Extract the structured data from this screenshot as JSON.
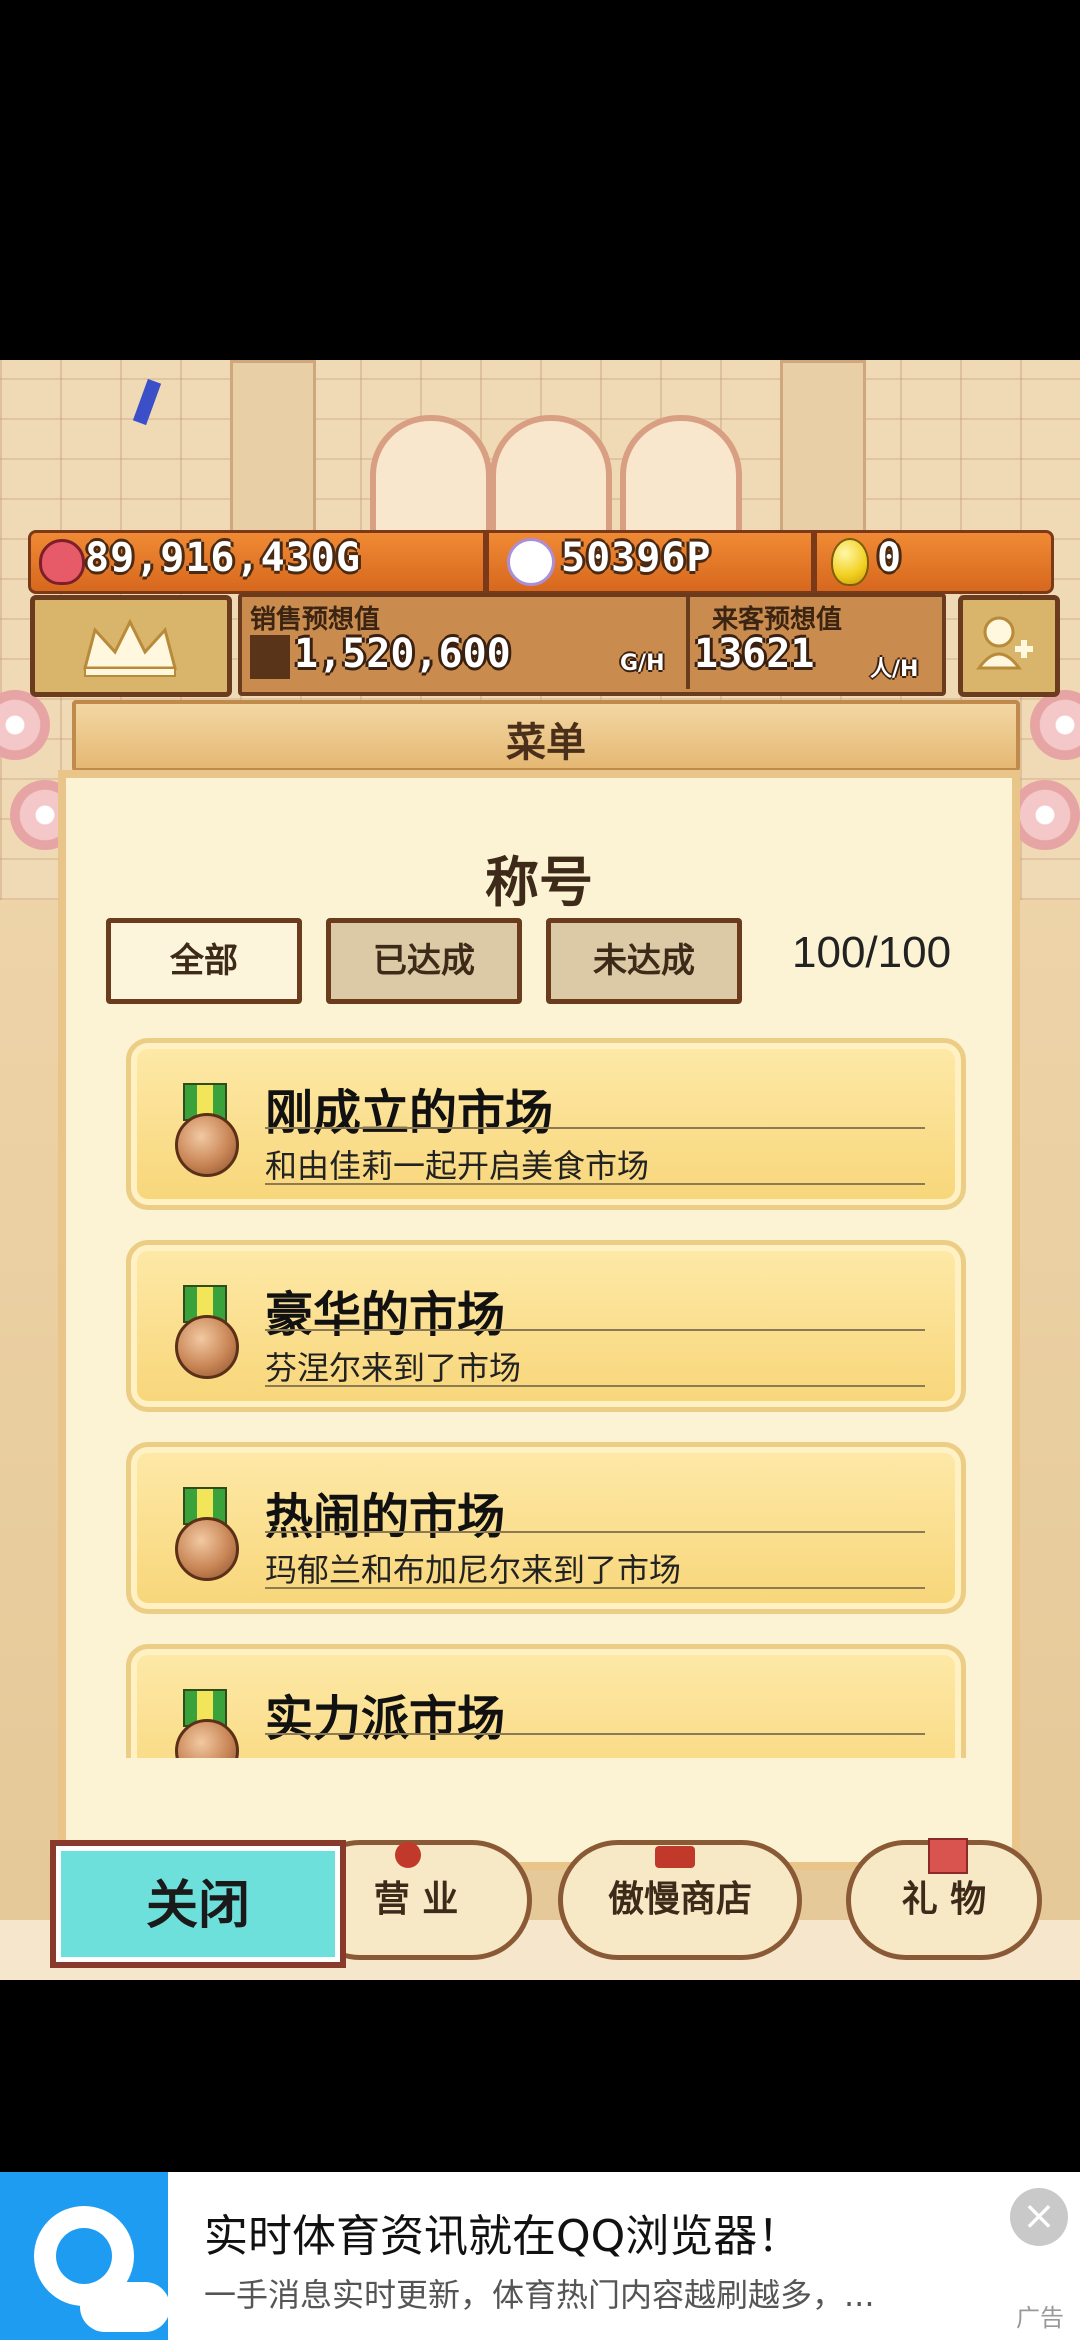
{
  "hud": {
    "gold": "89,916,430G",
    "points": "50396P",
    "eggs": "0",
    "sales_label": "销售预想值",
    "sales_value": "1,520,600",
    "sales_unit": "G/H",
    "visitors_label": "来客预想值",
    "visitors_value": "13621",
    "visitors_unit": "人/H"
  },
  "menu": {
    "header": "菜单",
    "section_title": "称号",
    "tabs": [
      "全部",
      "已达成",
      "未达成"
    ],
    "progress": "100/100"
  },
  "titles": [
    {
      "name": "刚成立的市场",
      "desc": "和由佳莉一起开启美食市场"
    },
    {
      "name": "豪华的市场",
      "desc": "芬涅尔来到了市场"
    },
    {
      "name": "热闹的市场",
      "desc": "玛郁兰和布加尼尔来到了市场"
    },
    {
      "name": "实力派市场",
      "desc": ""
    }
  ],
  "nav": {
    "close": "关闭",
    "business": "营 业",
    "shop": "傲慢商店",
    "gift": "礼 物"
  },
  "ad": {
    "title": "实时体育资讯就在QQ浏览器！",
    "desc": "一手消息实时更新，体育热门内容越刷越多，...",
    "label": "广告"
  },
  "icons": [
    "money-bag-icon",
    "smile-icon",
    "egg-icon",
    "crown-icon",
    "add-friend-icon",
    "medal-icon",
    "ladle-icon",
    "hat-icon",
    "gift-icon",
    "close-icon",
    "qq-browser-logo"
  ]
}
